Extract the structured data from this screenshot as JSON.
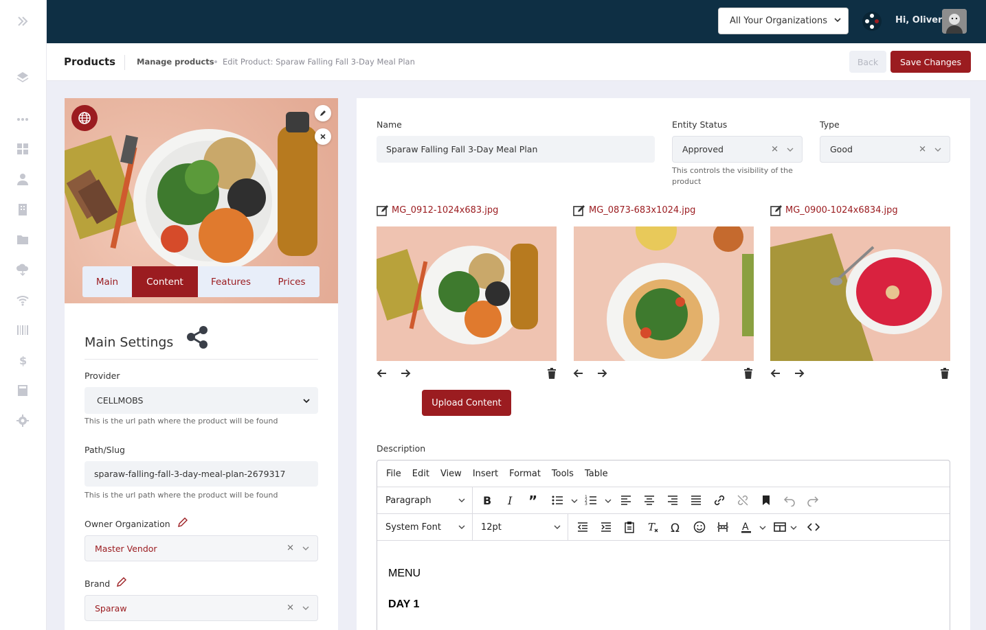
{
  "topbar": {
    "org_select": "All Your Organizations",
    "greeting": "Hi, Oliver"
  },
  "subbar": {
    "title": "Products",
    "breadcrumb": [
      "Manage products",
      "Edit Product: Sparaw Falling Fall 3-Day Meal Plan"
    ],
    "back_label": "Back",
    "save_label": "Save Changes"
  },
  "left": {
    "tabs": [
      "Main",
      "Content",
      "Features",
      "Prices"
    ],
    "active_tab": "Content",
    "section_title": "Main Settings",
    "provider": {
      "label": "Provider",
      "value": "CELLMOBS",
      "help": "This is the url path where the product will be found"
    },
    "path": {
      "label": "Path/Slug",
      "value": "sparaw-falling-fall-3-day-meal-plan-2679317",
      "help": "This is the url path where the product will be found"
    },
    "owner_org": {
      "label": "Owner Organization",
      "value": "Master Vendor"
    },
    "brand": {
      "label": "Brand",
      "value": "Sparaw"
    }
  },
  "right": {
    "name": {
      "label": "Name",
      "value": "Sparaw Falling Fall 3-Day Meal Plan"
    },
    "entity_status": {
      "label": "Entity Status",
      "value": "Approved",
      "help": "This controls the visibility of the product"
    },
    "type": {
      "label": "Type",
      "value": "Good"
    },
    "images": [
      {
        "file": "MG_0912-1024x683.jpg"
      },
      {
        "file": "MG_0873-683x1024.jpg"
      },
      {
        "file": "MG_0900-1024x6834.jpg"
      }
    ],
    "upload_label": "Upload Content",
    "description_label": "Description",
    "editor": {
      "menu": [
        "File",
        "Edit",
        "View",
        "Insert",
        "Format",
        "Tools",
        "Table"
      ],
      "block_format": "Paragraph",
      "font_family": "System Font",
      "font_size": "12pt",
      "content": [
        "MENU",
        "DAY 1"
      ]
    }
  },
  "colors": {
    "brand": "#9b1c20",
    "topbar": "#0e2f44",
    "background": "#edeef6"
  }
}
